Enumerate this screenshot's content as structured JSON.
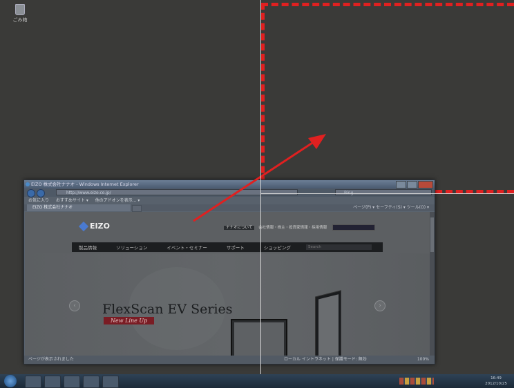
{
  "desktop": {
    "recycle_bin_label": "ごみ箱"
  },
  "ie": {
    "title": "EIZO 株式会社ナナオ - Windows Internet Explorer",
    "address": "http://www.eizo.co.jp/",
    "search_placeholder": "Bing",
    "favorites_label": "お気に入り",
    "suggested_sites": "おすすめサイト ▾",
    "addons": "他のアドオンを表示... ▾",
    "tab_label": "EIZO 株式会社ナナオ",
    "command_bar": "ページ(P) ▾  セーフティ(S) ▾  ツール(O) ▾",
    "status_left": "ページが表示されました",
    "status_zone": "ローカル イントラネット | 保護モード: 無効",
    "status_zoom": "100%"
  },
  "site": {
    "logo": "EIZO",
    "about_pill": "ナナオについて",
    "top_links": "会社情報・株主・投資家情報・採用情報",
    "nav": [
      "製品情報",
      "ソリューション",
      "イベント・セミナー",
      "サポート",
      "ショッピング"
    ],
    "search_placeholder": "Search",
    "hero_title": "FlexScan EV Series",
    "hero_sub": "New Line Up"
  },
  "taskbar": {
    "clock_time": "16:49",
    "clock_date": "2012/10/25"
  },
  "colors": {
    "annotation_red": "#e02020",
    "desktop_bg": "#3a3a38"
  }
}
